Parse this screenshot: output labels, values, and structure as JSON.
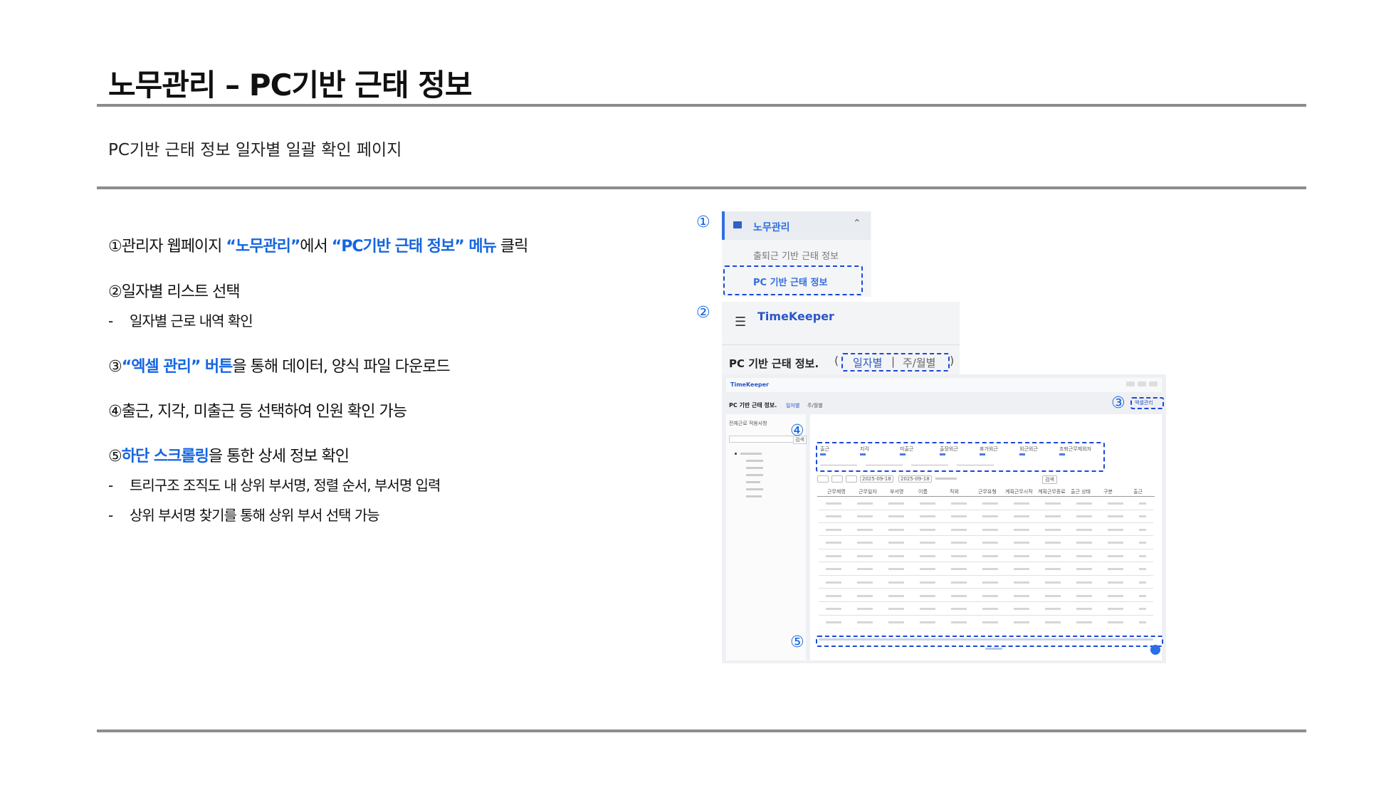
{
  "page": {
    "title": "노무관리 – PC기반 근태 정보",
    "subtitle": "PC기반 근태 정보 일자별 일괄 확인 페이지"
  },
  "steps": [
    {
      "num": "①",
      "pre": "관리자 웹페이지 ",
      "hl1": "“노무관리”",
      "mid": "에서 ",
      "hl2": "“PC기반 근태 정보” 메뉴",
      "post": " 클릭"
    },
    {
      "num": "②",
      "text": "일자별 리스트 선택",
      "sub": [
        "일자별 근로 내역 확인"
      ]
    },
    {
      "num": "③",
      "hl1": "“엑셀 관리” 버튼",
      "post": "을 통해 데이터, 양식 파일 다운로드"
    },
    {
      "num": "④",
      "text": "출근, 지각, 미출근 등 선택하여 인원 확인 가능"
    },
    {
      "num": "⑤",
      "hl1": "하단 스크롤링",
      "post": "을 통한 상세 정보 확인",
      "sub": [
        "트리구조 조직도 내 상위 부서명, 정렬 순서, 부서명 입력",
        "상위 부서명 찾기를 통해 상위 부서 선택 가능"
      ]
    }
  ],
  "screenshot1": {
    "marker": "①",
    "menu_label": "노무관리",
    "menu_item1": "출퇴근 기반 근태 정보",
    "menu_item2": "PC 기반 근태 정보"
  },
  "screenshot2": {
    "marker": "②",
    "app_name": "TimeKeeper",
    "page_title": "PC 기반 근태 정보.",
    "tab_daily": "일자별",
    "tab_weekly": "주/월별"
  },
  "screenshot3": {
    "marker3": "③",
    "marker4": "④",
    "marker5": "⑤",
    "app_name": "TimeKeeper",
    "page_title": "PC 기반 근태 정보.",
    "tab_daily": "일자별",
    "tab_weekly": "주/월별",
    "excel_button": "엑셀관리",
    "tree_label": "전체근로 적용사항",
    "search_button": "검색",
    "filters": [
      "출근",
      "지각",
      "미출근",
      "출장외근",
      "휴가외근",
      "외근외근",
      "조퇴근무제외자"
    ],
    "date_from": "2025-09-18",
    "date_to": "2025-09-18",
    "search_button2": "검색",
    "columns": [
      "근무제명",
      "근무일자",
      "부서명",
      "이름",
      "직위",
      "근무유형",
      "계획근무시작",
      "계획근무종료",
      "출근 상태",
      "구분",
      "출근"
    ]
  },
  "colors": {
    "accent": "#1565e0",
    "dash": "#1a48d8",
    "rule": "#8c8c8c"
  }
}
